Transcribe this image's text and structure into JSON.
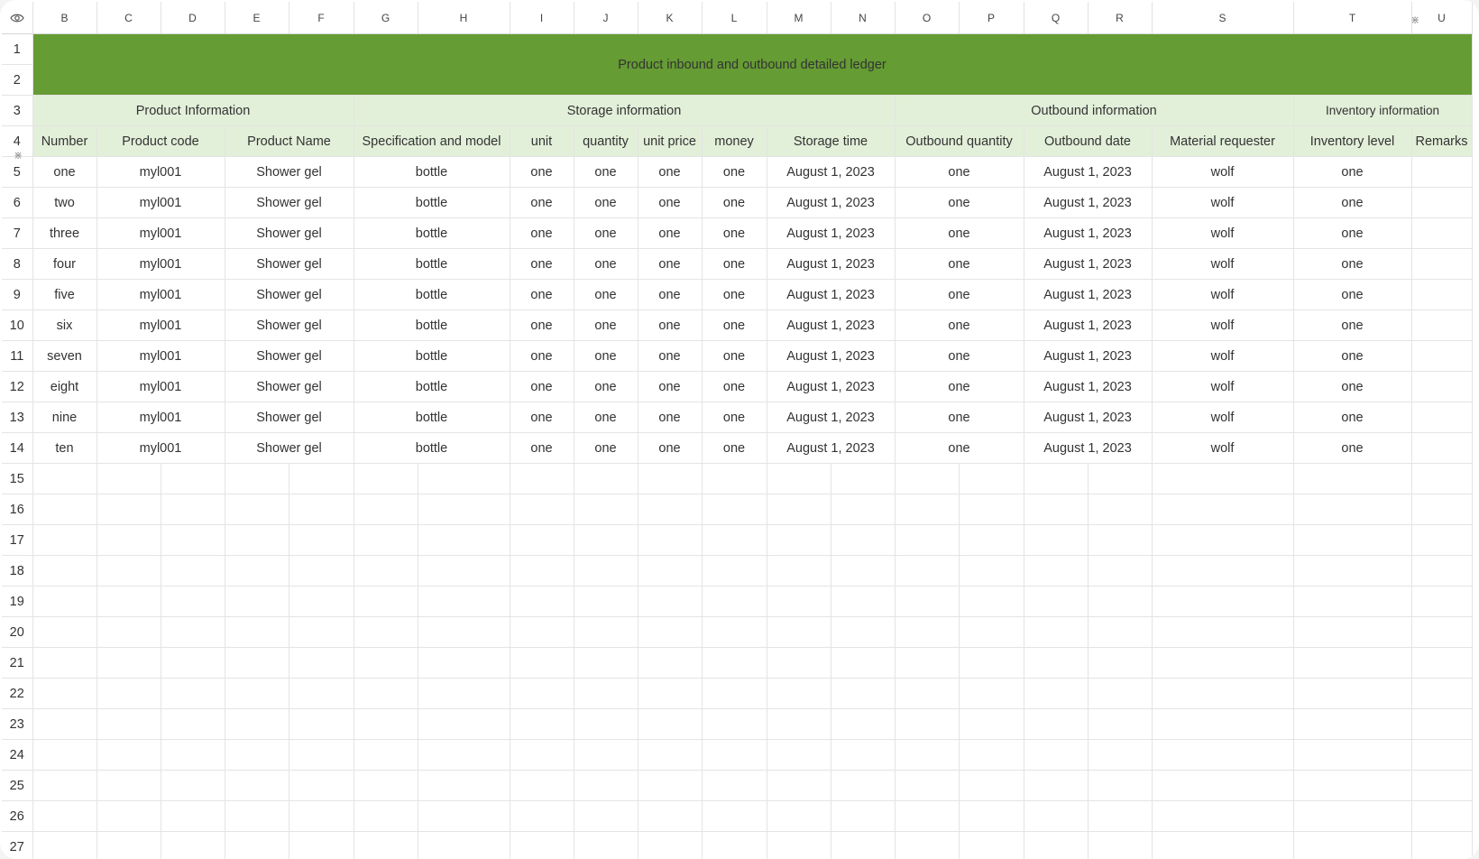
{
  "sheet": {
    "title": "Product inbound and outbound detailed ledger",
    "columns": [
      "B",
      "C",
      "D",
      "E",
      "F",
      "G",
      "H",
      "I",
      "J",
      "K",
      "L",
      "M",
      "N",
      "O",
      "P",
      "Q",
      "R",
      "S",
      "T",
      "U"
    ],
    "row_numbers": [
      "1",
      "2",
      "3",
      "4",
      "5",
      "6",
      "7",
      "8",
      "9",
      "10",
      "11",
      "12",
      "13",
      "14",
      "15",
      "16",
      "17",
      "18",
      "19",
      "20",
      "21",
      "22",
      "23",
      "24",
      "25",
      "26",
      "27"
    ],
    "groups": {
      "product": "Product Information",
      "storage": "Storage information",
      "outbound": "Outbound information",
      "inventory": "Inventory information"
    },
    "headers": [
      "Number",
      "Product code",
      "Product Name",
      "Specification and model",
      "unit",
      "quantity",
      "unit price",
      "money",
      "Storage time",
      "Outbound quantity",
      "Outbound date",
      "Material requester",
      "Inventory level",
      "Remarks"
    ],
    "rows": [
      [
        "one",
        "myl001",
        "Shower gel",
        "bottle",
        "one",
        "one",
        "one",
        "one",
        "August 1, 2023",
        "one",
        "August 1, 2023",
        "wolf",
        "one",
        ""
      ],
      [
        "two",
        "myl001",
        "Shower gel",
        "bottle",
        "one",
        "one",
        "one",
        "one",
        "August 1, 2023",
        "one",
        "August 1, 2023",
        "wolf",
        "one",
        ""
      ],
      [
        "three",
        "myl001",
        "Shower gel",
        "bottle",
        "one",
        "one",
        "one",
        "one",
        "August 1, 2023",
        "one",
        "August 1, 2023",
        "wolf",
        "one",
        ""
      ],
      [
        "four",
        "myl001",
        "Shower gel",
        "bottle",
        "one",
        "one",
        "one",
        "one",
        "August 1, 2023",
        "one",
        "August 1, 2023",
        "wolf",
        "one",
        ""
      ],
      [
        "five",
        "myl001",
        "Shower gel",
        "bottle",
        "one",
        "one",
        "one",
        "one",
        "August 1, 2023",
        "one",
        "August 1, 2023",
        "wolf",
        "one",
        ""
      ],
      [
        "six",
        "myl001",
        "Shower gel",
        "bottle",
        "one",
        "one",
        "one",
        "one",
        "August 1, 2023",
        "one",
        "August 1, 2023",
        "wolf",
        "one",
        ""
      ],
      [
        "seven",
        "myl001",
        "Shower gel",
        "bottle",
        "one",
        "one",
        "one",
        "one",
        "August 1, 2023",
        "one",
        "August 1, 2023",
        "wolf",
        "one",
        ""
      ],
      [
        "eight",
        "myl001",
        "Shower gel",
        "bottle",
        "one",
        "one",
        "one",
        "one",
        "August 1, 2023",
        "one",
        "August 1, 2023",
        "wolf",
        "one",
        ""
      ],
      [
        "nine",
        "myl001",
        "Shower gel",
        "bottle",
        "one",
        "one",
        "one",
        "one",
        "August 1, 2023",
        "one",
        "August 1, 2023",
        "wolf",
        "one",
        ""
      ],
      [
        "ten",
        "myl001",
        "Shower gel",
        "bottle",
        "one",
        "one",
        "one",
        "one",
        "August 1, 2023",
        "one",
        "August 1, 2023",
        "wolf",
        "one",
        ""
      ]
    ]
  },
  "icons": {
    "visibility": "eye-icon",
    "freeze": "freeze-handle-icon"
  },
  "colors": {
    "title_background": "#659c33",
    "header_background": "#e2efd9",
    "title_text": "#ffffff"
  }
}
